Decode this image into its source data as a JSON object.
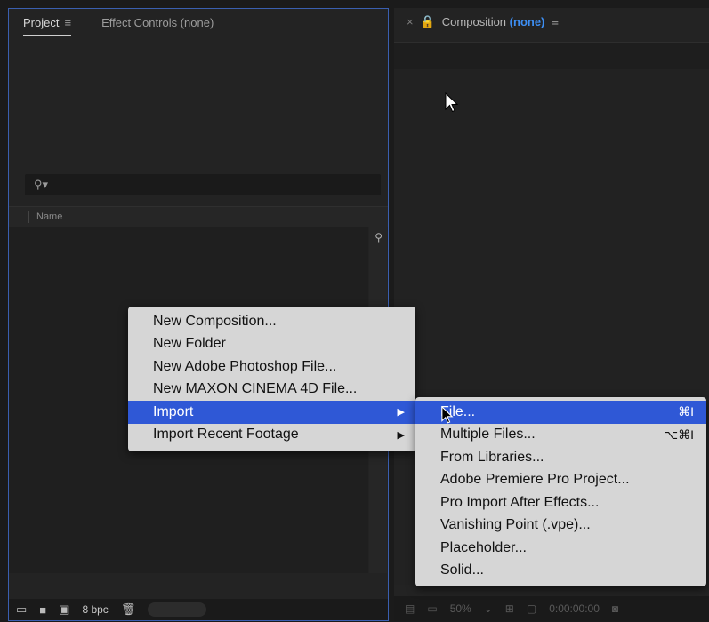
{
  "project_panel": {
    "tabs": [
      {
        "label": "Project"
      },
      {
        "label": "Effect Controls (none)"
      }
    ],
    "column_header": "Name",
    "bit_depth": "8 bpc"
  },
  "composition_panel": {
    "title": "Composition",
    "title_suffix": "(none)",
    "footer": {
      "zoom": "50%",
      "timecode": "0:00:00:00"
    }
  },
  "context_menu": {
    "items": [
      {
        "label": "New Composition..."
      },
      {
        "label": "New Folder"
      },
      {
        "label": "New Adobe Photoshop File..."
      },
      {
        "label": "New MAXON CINEMA 4D File..."
      },
      {
        "label": "Import",
        "highlighted": true
      },
      {
        "label": "Import Recent Footage"
      }
    ]
  },
  "import_submenu": {
    "items": [
      {
        "label": "File...",
        "shortcut": "⌘I",
        "highlighted": true
      },
      {
        "label": "Multiple Files...",
        "shortcut": "⌥⌘I"
      },
      {
        "label": "From Libraries..."
      },
      {
        "label": "Adobe Premiere Pro Project..."
      },
      {
        "label": "Pro Import After Effects..."
      },
      {
        "label": "Vanishing Point (.vpe)..."
      },
      {
        "label": "Placeholder..."
      },
      {
        "label": "Solid..."
      }
    ]
  },
  "colors": {
    "accent": "#2f58d6",
    "comp_none": "#3d8ef2",
    "panel_border": "#3a5fb0"
  }
}
